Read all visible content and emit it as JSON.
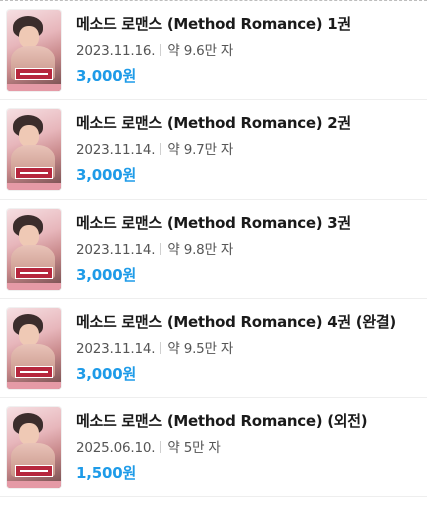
{
  "colors": {
    "price": "#1e9be8",
    "title": "#1a1a1a",
    "meta": "#555555",
    "divider": "#eeeeee"
  },
  "books": [
    {
      "cover_icon": "book-cover-image",
      "title": "메소드 로맨스 (Method Romance) 1권",
      "date": "2023.11.16.",
      "word_count": "약 9.6만 자",
      "price": "3,000원"
    },
    {
      "cover_icon": "book-cover-image",
      "title": "메소드 로맨스 (Method Romance) 2권",
      "date": "2023.11.14.",
      "word_count": "약 9.7만 자",
      "price": "3,000원"
    },
    {
      "cover_icon": "book-cover-image",
      "title": "메소드 로맨스 (Method Romance) 3권",
      "date": "2023.11.14.",
      "word_count": "약 9.8만 자",
      "price": "3,000원"
    },
    {
      "cover_icon": "book-cover-image",
      "title": "메소드 로맨스 (Method Romance) 4권 (완결)",
      "date": "2023.11.14.",
      "word_count": "약 9.5만 자",
      "price": "3,000원"
    },
    {
      "cover_icon": "book-cover-image",
      "title": "메소드 로맨스 (Method Romance) (외전)",
      "date": "2025.06.10.",
      "word_count": "약 5만 자",
      "price": "1,500원"
    }
  ]
}
